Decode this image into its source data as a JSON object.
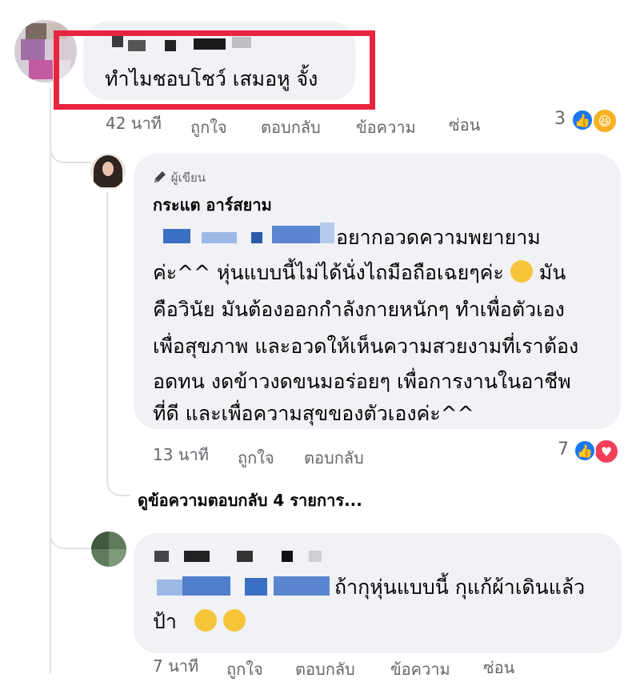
{
  "comments": [
    {
      "text": "ทำไมชอบโชว์  เสมอหู จั้ง",
      "time": "42 นาที",
      "actions": [
        "ถูกใจ",
        "ตอบกลับ",
        "ข้อความ",
        "ซ่อน"
      ],
      "reaction_count": "3",
      "reactions": [
        "like-icon",
        "haha-icon"
      ]
    },
    {
      "author_badge": "ผู้เขียน",
      "author": "กระแต อาร์สยาม",
      "lines": [
        "อยากอวดความพยายาม",
        "ค่ะ^^ หุ่นแบบนี้ไม่ได้นั่งไถมือถือเฉยๆค่ะ",
        "มัน",
        "คือวินัย มันต้องออกกำลังกายหนักๆ  ทำเพื่อตัวเอง",
        "เพื่อสุขภาพ และอวดให้เห็นความสวยงามที่เราต้อง",
        "อดทน งดข้าวงดขนมอร่อยๆ เพื่อการงานในอาชีพ",
        "ที่ดี และเพื่อความสุขของตัวเองค่ะ^^"
      ],
      "time": "13 นาที",
      "actions": [
        "ถูกใจ",
        "ตอบกลับ"
      ],
      "reaction_count": "7",
      "reactions": [
        "like-icon",
        "love-icon"
      ]
    },
    {
      "lines": [
        "ถ้ากุหุ่นแบบนี้ กุแก้ผ้าเดินแล้ว",
        "ป้า"
      ],
      "time": "7 นาที",
      "actions": [
        "ถูกใจ",
        "ตอบกลับ",
        "ข้อความ",
        "ซ่อน"
      ]
    }
  ],
  "view_replies": "ดูข้อความตอบกลับ 4 รายการ...",
  "colors": {
    "highlight": "#e8253f",
    "bubble": "#f0f2f5",
    "like": "#1877f2",
    "love": "#f33e58",
    "haha": "#f7b125"
  }
}
